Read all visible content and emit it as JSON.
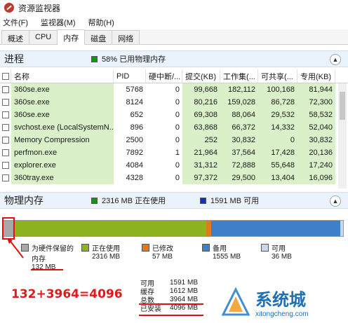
{
  "window": {
    "title": "资源监视器"
  },
  "menu": {
    "items": [
      "文件(F)",
      "监视器(M)",
      "帮助(H)"
    ]
  },
  "tabs": [
    "概述",
    "CPU",
    "内存",
    "磁盘",
    "网络"
  ],
  "active_tab": "内存",
  "process_section": {
    "title": "进程",
    "summary": "58% 已用物理内存",
    "summary_color": "#00a000",
    "columns": [
      "名称",
      "PID",
      "硬中断/...",
      "提交(KB)",
      "工作集(...",
      "可共享(...",
      "专用(KB)"
    ],
    "rows": [
      [
        "360se.exe",
        "5768",
        "0",
        "99,668",
        "182,112",
        "100,168",
        "81,944"
      ],
      [
        "360se.exe",
        "8124",
        "0",
        "80,216",
        "159,028",
        "86,728",
        "72,300"
      ],
      [
        "360se.exe",
        "652",
        "0",
        "69,308",
        "88,064",
        "29,532",
        "58,532"
      ],
      [
        "svchost.exe (LocalSystemN...",
        "896",
        "0",
        "63,868",
        "66,372",
        "14,332",
        "52,040"
      ],
      [
        "Memory Compression",
        "2500",
        "0",
        "252",
        "30,832",
        "0",
        "30,832"
      ],
      [
        "perfmon.exe",
        "7892",
        "1",
        "21,964",
        "37,564",
        "17,428",
        "20,136"
      ],
      [
        "explorer.exe",
        "4084",
        "0",
        "31,312",
        "72,888",
        "55,648",
        "17,240"
      ],
      [
        "360tray.exe",
        "4328",
        "0",
        "97,372",
        "29,500",
        "13,404",
        "16,096"
      ]
    ]
  },
  "memory_section": {
    "title": "物理内存",
    "in_use_summary": "2316 MB 正在使用",
    "available_summary": "1591 MB 可用",
    "bar": [
      {
        "key": "hw",
        "mb": 132,
        "color": "#a8a8a8"
      },
      {
        "key": "inuse",
        "mb": 2316,
        "color": "#8cb31e"
      },
      {
        "key": "modified",
        "mb": 57,
        "color": "#e07b1a"
      },
      {
        "key": "standby",
        "mb": 1555,
        "color": "#3f7fc9"
      },
      {
        "key": "free",
        "mb": 36,
        "color": "#c8d8ea"
      }
    ],
    "legend": [
      {
        "label": "为硬件保留的",
        "label2": "内存",
        "value": "132 MB",
        "color": "#a8a8a8"
      },
      {
        "label": "正在使用",
        "value": "2316 MB",
        "color": "#8cb31e"
      },
      {
        "label": "已修改",
        "value": "57 MB",
        "color": "#e07b1a"
      },
      {
        "label": "备用",
        "value": "1555 MB",
        "color": "#3f7fc9"
      },
      {
        "label": "可用",
        "value": "36 MB",
        "color": "#c8d8ea"
      }
    ],
    "stats": [
      {
        "k": "可用",
        "v": "1591 MB"
      },
      {
        "k": "缓存",
        "v": "1612 MB"
      },
      {
        "k": "总数",
        "v": "3964 MB"
      },
      {
        "k": "已安装",
        "v": "4096 MB"
      }
    ]
  },
  "annotation": {
    "equation": "132+3964=4096",
    "color": "#e01010"
  },
  "watermark": {
    "name": "系统城",
    "url": "xitongcheng.com"
  }
}
